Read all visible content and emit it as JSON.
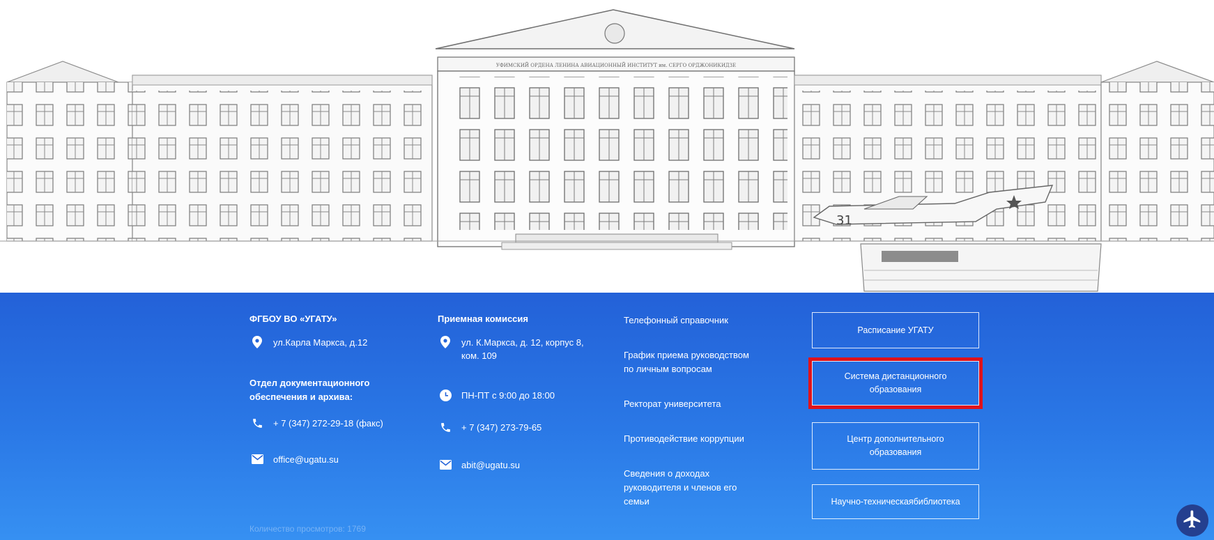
{
  "hero": {
    "facade_inscription": "УФИМСКИЙ ОРДЕНА ЛЕНИНА АВИАЦИОННЫЙ ИНСТИТУТ им. СЕРГО ОРДЖОНИКИДЗЕ",
    "plane_number": "31"
  },
  "footer": {
    "col1": {
      "title": "ФГБОУ ВО «УГАТУ»",
      "address": "ул.Карла Маркса, д.12",
      "dept_line1": "Отдел документационного",
      "dept_line2": "обеспечения и архива:",
      "phone": "+ 7 (347) 272-29-18 (факс)",
      "email": "office@ugatu.su"
    },
    "col2": {
      "title": "Приемная комиссия",
      "address_line1": "ул. К.Маркса, д. 12, корпус 8,",
      "address_line2": "ком. 109",
      "hours": "ПН-ПТ с 9:00 до 18:00",
      "phone": "+ 7 (347) 273-79-65",
      "email": "abit@ugatu.su"
    },
    "links": [
      {
        "line1": "Телефонный справочник",
        "line2": ""
      },
      {
        "line1": "График приема руководством",
        "line2": "по личным вопросам"
      },
      {
        "line1": "Ректорат университета",
        "line2": ""
      },
      {
        "line1": "Противодействие коррупции",
        "line2": ""
      },
      {
        "line1": "Сведения о доходах",
        "line2": "руководителя и членов его",
        "line3": "семьи"
      }
    ],
    "buttons": [
      {
        "line1": "Расписание УГАТУ",
        "line2": ""
      },
      {
        "line1": "Система дистанционного",
        "line2": "образования"
      },
      {
        "line1": "Центр дополнительного",
        "line2": "образования"
      },
      {
        "line1": "Научно-техническаябиблиотека",
        "line2": ""
      }
    ],
    "views": "Количество просмотров: 1769"
  },
  "colors": {
    "footer_top": "#2361d8",
    "footer_bottom": "#3690f2",
    "highlight": "#e0131b",
    "plane_button": "#243f8f"
  },
  "icons": [
    "location-pin-icon",
    "phone-icon",
    "email-icon",
    "clock-icon",
    "airplane-icon"
  ]
}
